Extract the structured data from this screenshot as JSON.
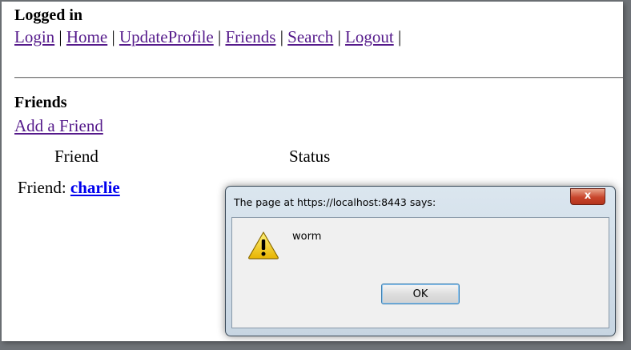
{
  "page": {
    "status": "Logged in",
    "nav": [
      "Login",
      "Home",
      "UpdateProfile",
      "Friends",
      "Search",
      "Logout"
    ],
    "nav_separator": "|",
    "section_title": "Friends",
    "add_friend_link": "Add a Friend",
    "columns": {
      "friend": "Friend",
      "status": "Status"
    },
    "friend_row": {
      "label": "Friend:",
      "name": "charlie"
    }
  },
  "dialog": {
    "title": "The page at https://localhost:8443 says:",
    "close_label": "x",
    "message": "worm",
    "ok_label": "OK",
    "icon": "warning-icon"
  },
  "colors": {
    "visited_link": "#551a8b",
    "link": "#0000ee",
    "close_button": "#c8452c",
    "annotation_arrow": "#f2b900"
  }
}
